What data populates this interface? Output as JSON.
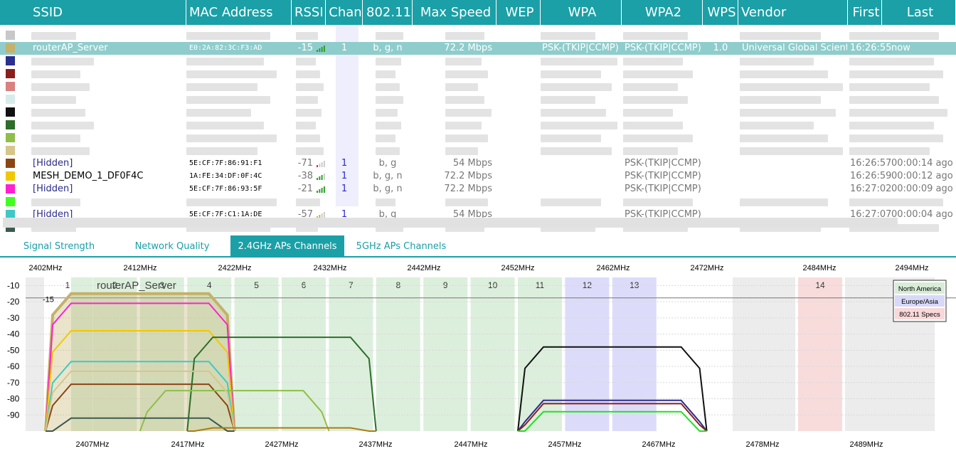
{
  "columns": [
    "SSID",
    "MAC Address",
    "RSSI",
    "Chan",
    "802.11",
    "Max Speed",
    "WEP",
    "WPA",
    "WPA2",
    "WPS",
    "Vendor",
    "First",
    "Last"
  ],
  "rows": [
    {
      "color": "#c8c8c8",
      "blur": true
    },
    {
      "color": "#c4b16a",
      "selected": true,
      "ssid": "routerAP_Server",
      "mac": "E0:2A:82:3C:F3:AD",
      "rssi": "-15",
      "chan": "1",
      "std": "b, g, n",
      "speed": "72.2 Mbps",
      "wpa": "PSK-(TKIP|CCMP)",
      "wpa2": "PSK-(TKIP|CCMP)",
      "wps": "1.0",
      "vendor": "Universal Global Scientif",
      "first": "16:26:55",
      "last": "now"
    },
    {
      "color": "#2b2f8f",
      "blur": true
    },
    {
      "color": "#8b1d1d",
      "blur": true
    },
    {
      "color": "#d98080",
      "blur": true
    },
    {
      "color": "#d6ecea",
      "blur": true
    },
    {
      "color": "#111111",
      "blur": true
    },
    {
      "color": "#2c6e2a",
      "blur": true
    },
    {
      "color": "#8fbf4a",
      "blur": true
    },
    {
      "color": "#d6c68a",
      "blur": true
    },
    {
      "color": "#8b4513",
      "ssid": "[Hidden]",
      "hidden": true,
      "mac": "5E:CF:7F:86:91:F1",
      "rssi": "-71",
      "chan": "1",
      "std": "b, g",
      "speed": "54 Mbps",
      "wpa2": "PSK-(TKIP|CCMP)",
      "first": "16:26:57",
      "last": "00:00:14 ago"
    },
    {
      "color": "#f0c800",
      "ssid": "MESH_DEMO_1_DF0F4C",
      "mac": "1A:FE:34:DF:0F:4C",
      "rssi": "-38",
      "chan": "1",
      "std": "b, g, n",
      "speed": "72.2 Mbps",
      "wpa2": "PSK-(TKIP|CCMP)",
      "first": "16:26:59",
      "last": "00:00:12 ago"
    },
    {
      "color": "#ff20d0",
      "ssid": "[Hidden]",
      "hidden": true,
      "mac": "5E:CF:7F:86:93:5F",
      "rssi": "-21",
      "chan": "1",
      "std": "b, g, n",
      "speed": "72.2 Mbps",
      "wpa2": "PSK-(TKIP|CCMP)",
      "first": "16:27:02",
      "last": "00:00:09 ago"
    },
    {
      "color": "#40ff20",
      "blur": true
    },
    {
      "color": "#40c8c8",
      "ssid": "[Hidden]",
      "hidden": true,
      "mac": "5E:CF:7F:C1:1A:DE",
      "rssi": "-57",
      "chan": "1",
      "std": "b, g",
      "speed": "54 Mbps",
      "wpa2": "PSK-(TKIP|CCMP)",
      "first": "16:27:07",
      "last": "00:00:04 ago"
    },
    {
      "color": "#3c5a50",
      "blur": true
    }
  ],
  "tabs": [
    "Signal Strength",
    "Network Quality",
    "2.4GHz APs Channels",
    "5GHz APs Channels"
  ],
  "active_tab": 2,
  "chart_data": {
    "type": "area",
    "top_labels": [
      "2402MHz",
      "2412MHz",
      "2422MHz",
      "2432MHz",
      "2442MHz",
      "2452MHz",
      "2462MHz",
      "2472MHz",
      "2484MHz",
      "2494MHz"
    ],
    "bottom_labels": [
      "2407MHz",
      "2417MHz",
      "2427MHz",
      "2437MHz",
      "2447MHz",
      "2457MHz",
      "2467MHz",
      "2478MHz",
      "2489MHz"
    ],
    "channels": [
      "1",
      "2",
      "3",
      "4",
      "5",
      "6",
      "7",
      "8",
      "9",
      "10",
      "11",
      "12",
      "13",
      "14"
    ],
    "y_ticks": [
      "-10",
      "-20",
      "-30",
      "-40",
      "-50",
      "-60",
      "-70",
      "-80",
      "-90"
    ],
    "ylim": [
      -100,
      -5
    ],
    "selected_label": "routerAP_Server",
    "selected_rssi": "-15",
    "legend": [
      {
        "label": "North America",
        "color": "#d8ecd8"
      },
      {
        "label": "Europe/Asia",
        "color": "#d8d8f8"
      },
      {
        "label": "802.11 Specs",
        "color": "#f8d8d8"
      }
    ],
    "series": [
      {
        "name": "routerAP_Server",
        "channel": 1,
        "rssi": -15,
        "color": "#c4b16a"
      },
      {
        "name": "[Hidden]",
        "channel": 1,
        "rssi": -21,
        "color": "#ff20d0"
      },
      {
        "name": "MESH_DEMO_1_DF0F4C",
        "channel": 1,
        "rssi": -38,
        "color": "#f0c800"
      },
      {
        "name": "[Hidden]",
        "channel": 1,
        "rssi": -57,
        "color": "#40c8c8"
      },
      {
        "name": "[Hidden]",
        "channel": 1,
        "rssi": -71,
        "color": "#8b4513"
      },
      {
        "channel": 4,
        "rssi": -42,
        "color": "#2c6e2a"
      },
      {
        "channel": 3,
        "rssi": -75,
        "color": "#8fbf4a"
      },
      {
        "channel": 1,
        "rssi": -63,
        "color": "#d6c68a"
      },
      {
        "channel": 1,
        "rssi": -92,
        "color": "#3c5a50"
      },
      {
        "channel": 4,
        "rssi": -98,
        "color": "#b07a10"
      },
      {
        "channel": 11,
        "rssi": -48,
        "color": "#111111"
      },
      {
        "channel": 11,
        "rssi": -81,
        "color": "#2b2f8f"
      },
      {
        "channel": 11,
        "rssi": -83,
        "color": "#8b1d1d"
      },
      {
        "channel": 11,
        "rssi": -88,
        "color": "#20e020"
      }
    ]
  }
}
